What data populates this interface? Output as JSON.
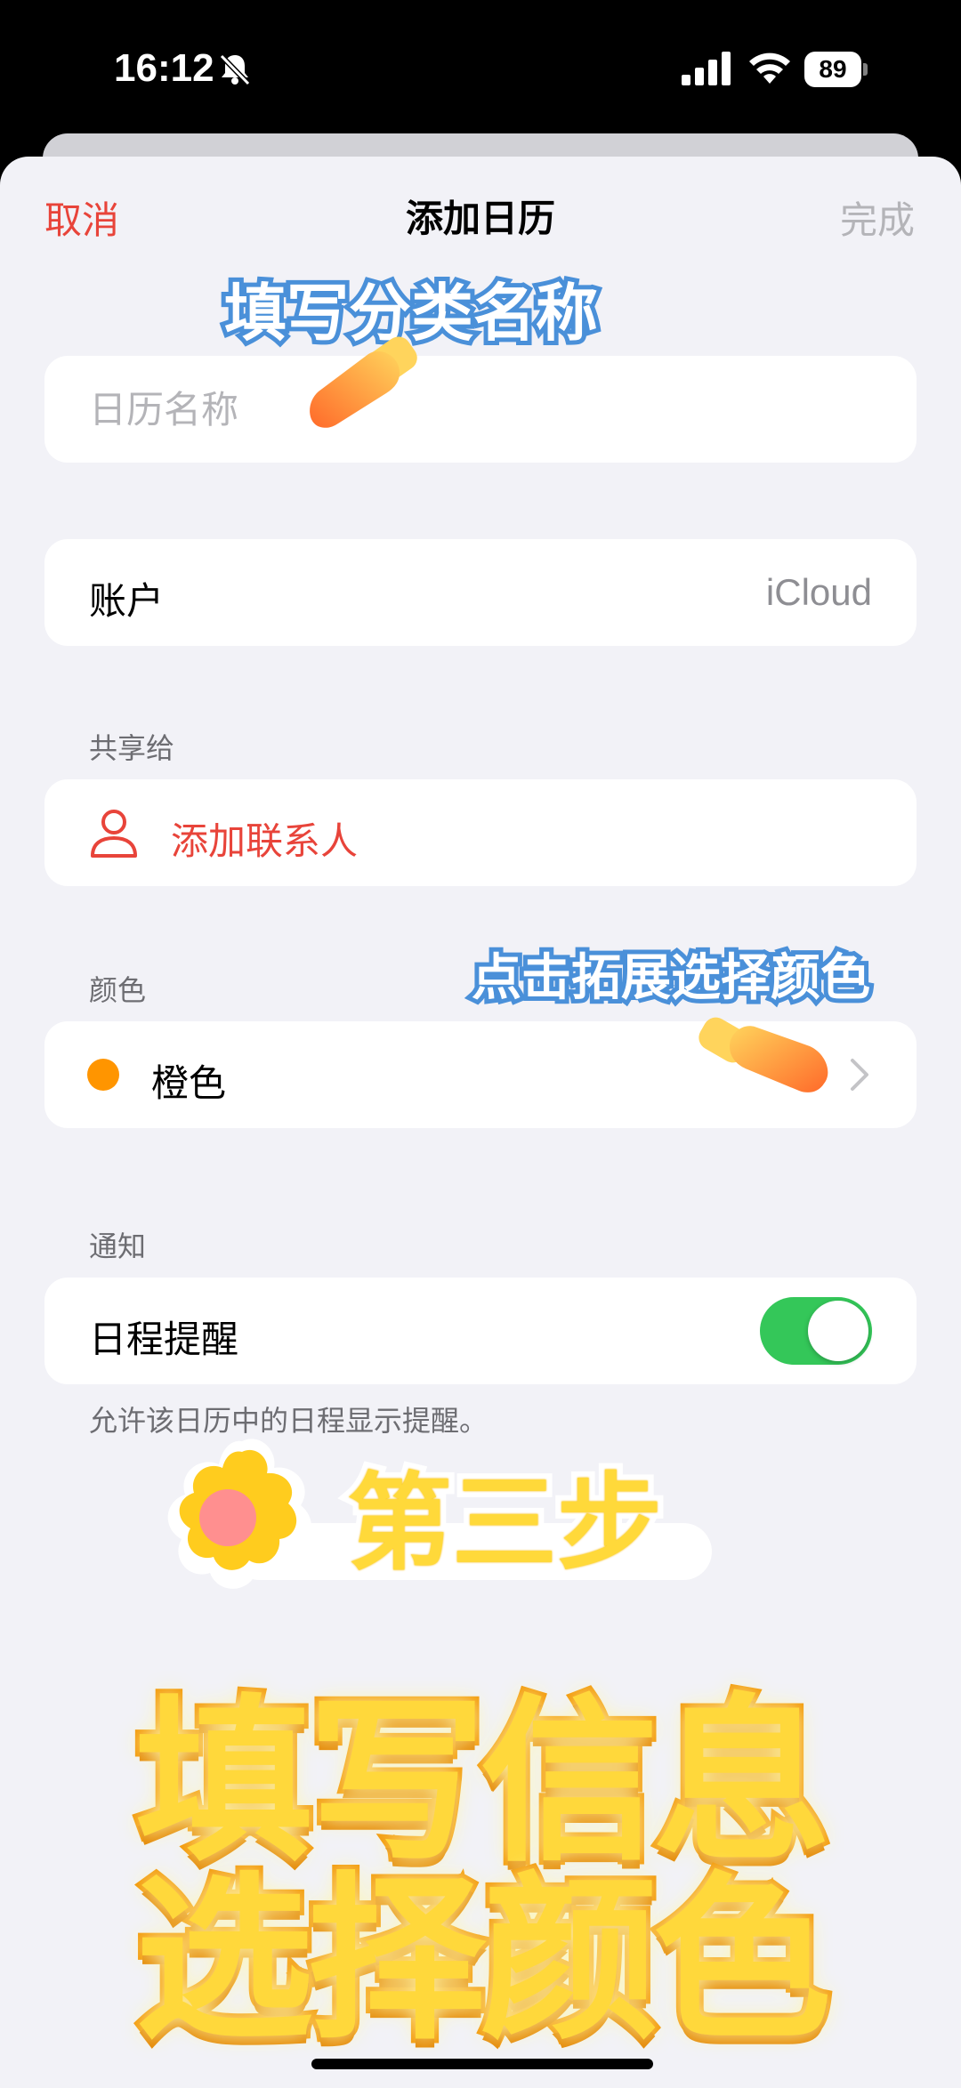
{
  "status_bar": {
    "time": "16:12",
    "battery": "89"
  },
  "nav": {
    "cancel": "取消",
    "title": "添加日历",
    "done": "完成"
  },
  "name_field": {
    "placeholder": "日历名称",
    "value": ""
  },
  "account": {
    "label": "账户",
    "value": "iCloud"
  },
  "share": {
    "section": "共享给",
    "add_contact": "添加联系人"
  },
  "color": {
    "section": "颜色",
    "value": "橙色",
    "swatch": "#ff9500"
  },
  "notify": {
    "section": "通知",
    "label": "日程提醒",
    "enabled": true,
    "note": "允许该日历中的日程显示提醒。"
  },
  "overlays": {
    "callout_name": "填写分类名称",
    "callout_color": "点击拓展选择颜色",
    "step": "第三步",
    "big_line1": "填写信息",
    "big_line2": "选择颜色"
  },
  "colors": {
    "accent_red": "#e8443a",
    "toggle_green": "#34c759",
    "orange": "#ff9500"
  }
}
